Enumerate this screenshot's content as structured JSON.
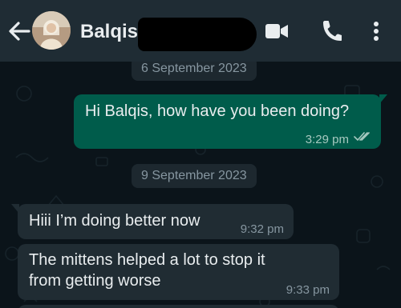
{
  "header": {
    "contact_name": "Balqis .",
    "back_icon": "arrow-left-icon",
    "video_call_icon": "video-camera-icon",
    "voice_call_icon": "phone-icon",
    "menu_icon": "more-vertical-icon"
  },
  "chat": {
    "date_chips": [
      "6 September 2023",
      "9 September 2023"
    ],
    "messages": [
      {
        "direction": "outgoing",
        "text": "Hi Balqis, how have you been doing?",
        "time": "3:29 pm",
        "status": "read"
      },
      {
        "direction": "incoming",
        "text": "Hiii I’m doing better now",
        "time": "9:32 pm"
      },
      {
        "direction": "incoming",
        "lines": [
          "The mittens helped a lot to stop it",
          "from getting worse"
        ],
        "time": "9:33 pm"
      }
    ]
  },
  "colors": {
    "header_bg": "#1f2c34",
    "chat_bg": "#0b141a",
    "outgoing_bubble": "#005c4b",
    "incoming_bubble": "#202c33",
    "read_ticks": "#a7c9c0"
  }
}
